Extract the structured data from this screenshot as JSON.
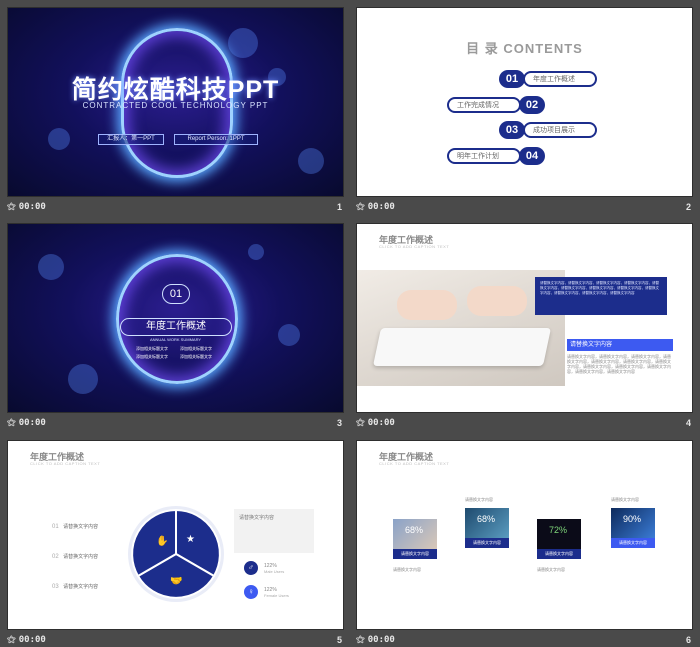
{
  "slides": [
    {
      "number": "1",
      "time": "00:00",
      "title": "简约炫酷科技PPT",
      "subtitle": "CONTRACTED COOL TECHNOLOGY PPT",
      "reporter": "汇报人：第一PPT",
      "report_person": "Report Person: 1PPT"
    },
    {
      "number": "2",
      "time": "00:00",
      "toc_title": "目 录   CONTENTS",
      "items": [
        {
          "num": "01",
          "label": "年度工作概述"
        },
        {
          "num": "02",
          "label": "工作完成情况"
        },
        {
          "num": "03",
          "label": "成功项目展示"
        },
        {
          "num": "04",
          "label": "明年工作计划"
        }
      ]
    },
    {
      "number": "3",
      "time": "00:00",
      "num": "01",
      "title": "年度工作概述",
      "en": "ANNUAL WORK SUMMARY",
      "bullets": [
        "添加相关标题文字",
        "添加相关标题文字",
        "添加相关标题文字",
        "添加相关标题文字"
      ]
    },
    {
      "number": "4",
      "time": "00:00",
      "title": "年度工作概述",
      "sub": "CLICK TO ADD CAPTION TEXT",
      "body_text": "请替换文字内容，请替换文字内容，请替换文字内容，请替换文字内容，请替换文字内容，请替换文字内容，请替换文字内容，请替换文字内容，请替换文字内容，请替换文字内容，请替换文字内容，请替换文字内容",
      "highlight": "请替换文字内容"
    },
    {
      "number": "5",
      "time": "00:00",
      "title": "年度工作概述",
      "sub": "CLICK TO ADD CAPTION TEXT",
      "list": [
        {
          "n": "01",
          "t": "请替换文字内容"
        },
        {
          "n": "02",
          "t": "请替换文字内容"
        },
        {
          "n": "03",
          "t": "请替换文字内容"
        }
      ],
      "box_title": "请替换文字内容",
      "male_pct": "122%",
      "male_label": "Male Users",
      "female_pct": "122%",
      "female_label": "Female Users"
    },
    {
      "number": "6",
      "time": "00:00",
      "title": "年度工作概述",
      "sub": "CLICK TO ADD CAPTION TEXT",
      "cards": [
        {
          "pct": "68%",
          "caption": "请替换文字内容",
          "label": "请替换文字内容"
        },
        {
          "pct": "68%",
          "caption": "请替换文字内容",
          "label": "请替换文字内容"
        },
        {
          "pct": "72%",
          "caption": "请替换文字内容",
          "label": "请替换文字内容"
        },
        {
          "pct": "90%",
          "caption": "请替换文字内容",
          "label": "请替换文字内容"
        }
      ]
    }
  ],
  "colors": {
    "navy": "#1c2d8c",
    "accent": "#3d5af1",
    "bg": "#4a4a4a"
  }
}
